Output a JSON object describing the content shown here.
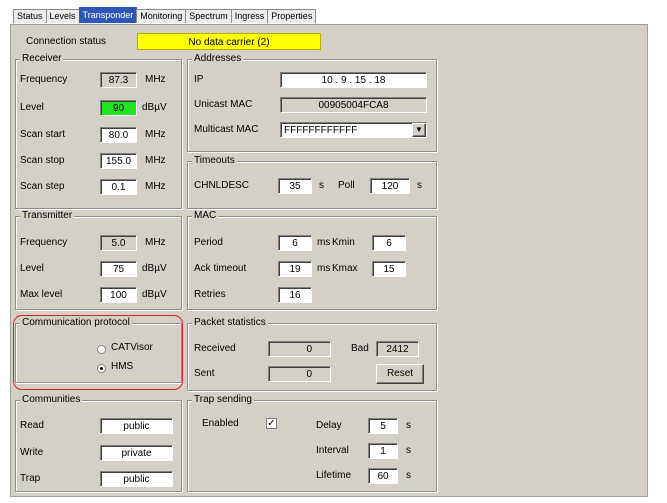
{
  "tabs": [
    "Status",
    "Levels",
    "Transponder",
    "Monitoring",
    "Spectrum",
    "Ingress",
    "Properties"
  ],
  "active_tab": "Transponder",
  "connection": {
    "label": "Connection status",
    "value": "No data carrier (2)",
    "highlight_color": "#ffff00"
  },
  "receiver": {
    "title": "Receiver",
    "frequency": {
      "label": "Frequency",
      "value": "87.3",
      "unit": "MHz"
    },
    "level": {
      "label": "Level",
      "value": "90",
      "unit": "dBµV",
      "highlight_color": "#22e322"
    },
    "scan_start": {
      "label": "Scan start",
      "value": "80.0",
      "unit": "MHz"
    },
    "scan_stop": {
      "label": "Scan stop",
      "value": "155.0",
      "unit": "MHz"
    },
    "scan_step": {
      "label": "Scan step",
      "value": "0.1",
      "unit": "MHz"
    }
  },
  "addresses": {
    "title": "Addresses",
    "ip": {
      "label": "IP",
      "value": "10 . 9 . 15 . 18"
    },
    "unicast_mac": {
      "label": "Unicast MAC",
      "value": "00905004FCA8"
    },
    "multicast_mac": {
      "label": "Multicast MAC",
      "value": "FFFFFFFFFFFF"
    }
  },
  "timeouts": {
    "title": "Timeouts",
    "chnldesc": {
      "label": "CHNLDESC",
      "value": "35",
      "unit": "s"
    },
    "poll": {
      "label": "Poll",
      "value": "120",
      "unit": "s"
    }
  },
  "transmitter": {
    "title": "Transmitter",
    "frequency": {
      "label": "Frequency",
      "value": "5.0",
      "unit": "MHz"
    },
    "level": {
      "label": "Level",
      "value": "75",
      "unit": "dBµV"
    },
    "max_level": {
      "label": "Max level",
      "value": "100",
      "unit": "dBµV"
    }
  },
  "mac": {
    "title": "MAC",
    "period": {
      "label": "Period",
      "value": "6",
      "unit": "ms",
      "kmin_label": "Kmin",
      "kmin_value": "6"
    },
    "ack_timeout": {
      "label": "Ack timeout",
      "value": "19",
      "unit": "ms",
      "kmax_label": "Kmax",
      "kmax_value": "15"
    },
    "retries": {
      "label": "Retries",
      "value": "16"
    }
  },
  "protocol": {
    "title": "Communication protocol",
    "options": [
      "CATVisor",
      "HMS"
    ],
    "selected": "HMS",
    "annotation_color": "#e02020"
  },
  "packet_statistics": {
    "title": "Packet statistics",
    "received": {
      "label": "Received",
      "value": "0"
    },
    "bad": {
      "label": "Bad",
      "value": "2412"
    },
    "sent": {
      "label": "Sent",
      "value": "0"
    },
    "reset_label": "Reset"
  },
  "communities": {
    "title": "Communities",
    "read": {
      "label": "Read",
      "value": "public"
    },
    "write": {
      "label": "Write",
      "value": "private"
    },
    "trap": {
      "label": "Trap",
      "value": "public"
    }
  },
  "trap_sending": {
    "title": "Trap sending",
    "enabled": {
      "label": "Enabled",
      "checked": true,
      "mark": "✓"
    },
    "delay": {
      "label": "Delay",
      "value": "5",
      "unit": "s"
    },
    "interval": {
      "label": "Interval",
      "value": "1",
      "unit": "s"
    },
    "lifetime": {
      "label": "Lifetime",
      "value": "60",
      "unit": "s"
    }
  }
}
